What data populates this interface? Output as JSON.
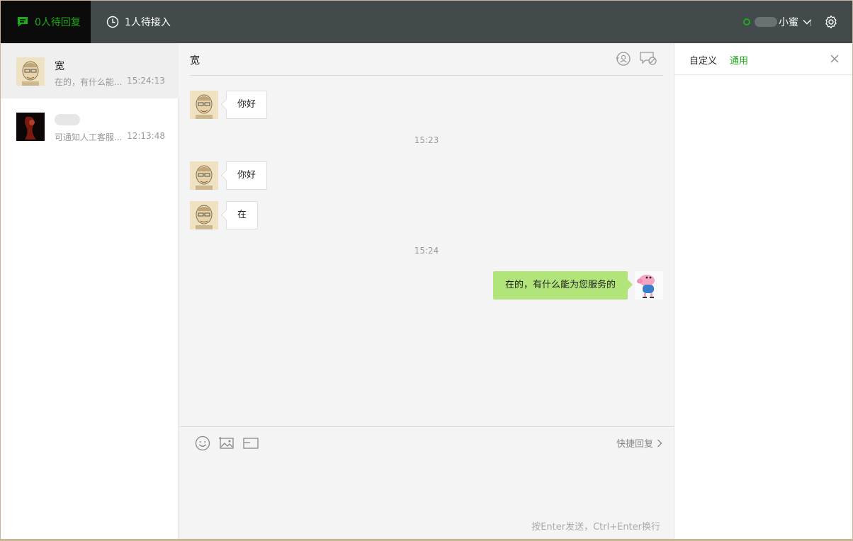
{
  "topbar": {
    "tab_reply": "0人待回复",
    "tab_waiting": "1人待接入",
    "user_name_suffix": "小蜜",
    "status_color": "#1aad19"
  },
  "conversations": [
    {
      "name": "宽",
      "preview": "在的，有什么能...",
      "time": "15:24:13",
      "active": true
    },
    {
      "name": "",
      "preview": "可通知人工客服...",
      "time": "12:13:48",
      "active": false
    }
  ],
  "chat": {
    "title": "宽",
    "messages": [
      {
        "type": "in",
        "text": "你好"
      },
      {
        "type": "time",
        "text": "15:23"
      },
      {
        "type": "in",
        "text": "你好"
      },
      {
        "type": "in",
        "text": "在"
      },
      {
        "type": "time",
        "text": "15:24"
      },
      {
        "type": "out",
        "text": "在的，有什么能为您服务的"
      }
    ],
    "quick_reply": "快捷回复",
    "send_hint": "按Enter发送，Ctrl+Enter换行"
  },
  "right_panel": {
    "tab_custom": "自定义",
    "tab_general": "通用"
  },
  "icons": {
    "tab_reply": "chat-bubble-icon",
    "tab_waiting": "clock-icon",
    "settings": "gear-icon",
    "transfer": "transfer-user-icon",
    "block": "block-chat-icon",
    "emoji": "emoji-icon",
    "image": "image-icon",
    "card": "card-icon",
    "close": "close-icon"
  }
}
